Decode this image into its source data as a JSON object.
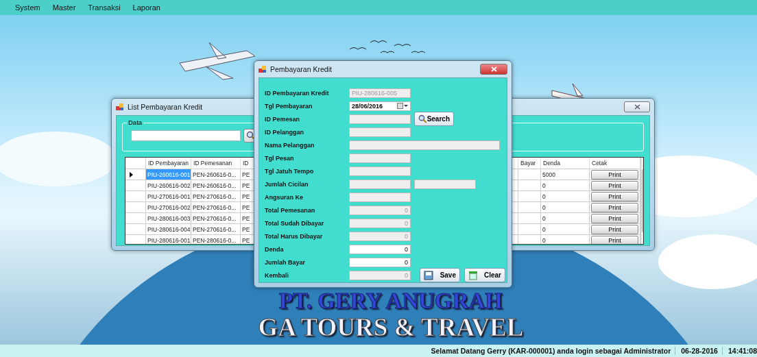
{
  "menu": [
    {
      "label": "System"
    },
    {
      "label": "Master"
    },
    {
      "label": "Transaksi"
    },
    {
      "label": "Laporan"
    }
  ],
  "list_window": {
    "title": "List Pembayaran Kredit",
    "group_label": "Data",
    "table": {
      "columns": [
        "ID Pembayaran",
        "ID Pemesanan",
        "ID",
        "Bayar",
        "Denda",
        "Cetak"
      ],
      "rows": [
        {
          "selected": true,
          "id_pembayaran": "PIU-260616-001",
          "id_pemesanan": "PEN-260616-0...",
          "column_3": "PE",
          "denda": "5000",
          "cetak": "Print"
        },
        {
          "selected": false,
          "id_pembayaran": "PIU-260616-002",
          "id_pemesanan": "PEN-260616-0...",
          "column_3": "PE",
          "denda": "0",
          "cetak": "Print"
        },
        {
          "selected": false,
          "id_pembayaran": "PIU-270616-001",
          "id_pemesanan": "PEN-270616-0...",
          "column_3": "PE",
          "denda": "0",
          "cetak": "Print"
        },
        {
          "selected": false,
          "id_pembayaran": "PIU-270616-002",
          "id_pemesanan": "PEN-270616-0...",
          "column_3": "PE",
          "denda": "0",
          "cetak": "Print"
        },
        {
          "selected": false,
          "id_pembayaran": "PIU-280616-003",
          "id_pemesanan": "PEN-270616-0...",
          "column_3": "PE",
          "denda": "0",
          "cetak": "Print"
        },
        {
          "selected": false,
          "id_pembayaran": "PIU-280616-004",
          "id_pemesanan": "PEN-270616-0...",
          "column_3": "PE",
          "denda": "0",
          "cetak": "Print"
        },
        {
          "selected": false,
          "id_pembayaran": "PIU-280616-001",
          "id_pemesanan": "PEN-280616-0...",
          "column_3": "PE",
          "denda": "0",
          "cetak": "Print"
        }
      ]
    }
  },
  "dialog": {
    "title": "Pembayaran Kredit",
    "fields": [
      {
        "label": "ID Pembayaran Kredit",
        "kind": "short",
        "disabled": true,
        "value": "PIU-280616-005"
      },
      {
        "label": "Tgl Pembayaran",
        "kind": "date",
        "disabled": false,
        "value": "28/06/2016"
      },
      {
        "label": "ID Pemesan",
        "kind": "short",
        "disabled": true,
        "button": "Search"
      },
      {
        "label": "ID Pelanggan",
        "kind": "short",
        "disabled": true
      },
      {
        "label": "Nama Pelanggan",
        "kind": "wide",
        "disabled": true
      },
      {
        "label": "Tgl Pesan",
        "kind": "short",
        "disabled": true
      },
      {
        "label": "Tgl Jatuh Tempo",
        "kind": "short",
        "disabled": true
      },
      {
        "label": "Jumlah Cicilan",
        "kind": "pair",
        "disabled": true
      },
      {
        "label": "Angsuran Ke",
        "kind": "short",
        "disabled": true
      },
      {
        "label": "Total Pemesanan",
        "kind": "number",
        "disabled": true,
        "value": "0"
      },
      {
        "label": "Total Sudah Dibayar",
        "kind": "number",
        "disabled": true,
        "value": "0"
      },
      {
        "label": "Total Harus Dibayar",
        "kind": "number",
        "disabled": true,
        "value": "0"
      },
      {
        "label": "Denda",
        "kind": "number",
        "disabled": false,
        "value": "0"
      },
      {
        "label": "Jumlah Bayar",
        "kind": "number",
        "disabled": false,
        "value": "0"
      },
      {
        "label": "Kembali",
        "kind": "number",
        "disabled": true,
        "value": "0"
      }
    ],
    "actions": [
      {
        "label": "Save",
        "kind": "save"
      },
      {
        "label": "Clear",
        "kind": "clear"
      }
    ]
  },
  "logo": [
    "PT. GERY ANUGRAH",
    "GA TOURS & TRAVEL"
  ],
  "status_bar": {
    "message": "Selamat Datang Gerry (KAR-000001) anda login sebagai Administrator",
    "date": "06-28-2016",
    "time": "14:41:08"
  }
}
